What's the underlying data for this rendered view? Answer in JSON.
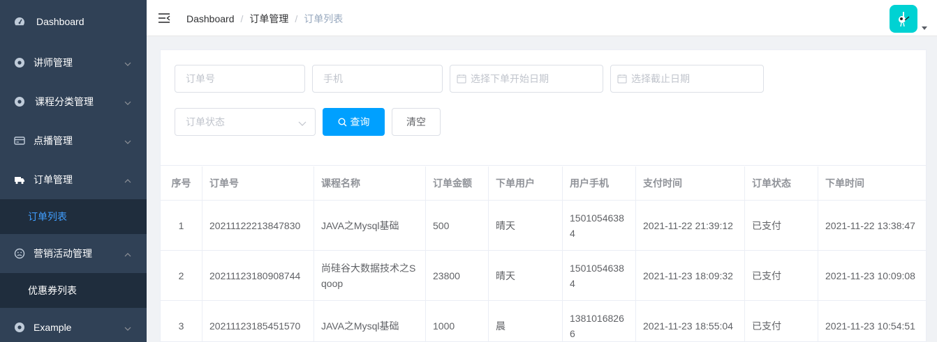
{
  "sidebar": {
    "items": [
      {
        "label": "Dashboard",
        "icon": "dashboard-icon",
        "has_arrow": false
      },
      {
        "label": "讲师管理",
        "icon": "circle-icon",
        "has_arrow": true,
        "arrow": "down"
      },
      {
        "label": "课程分类管理",
        "icon": "circle-icon",
        "has_arrow": true,
        "arrow": "down"
      },
      {
        "label": "点播管理",
        "icon": "card-icon",
        "has_arrow": true,
        "arrow": "down"
      },
      {
        "label": "订单管理",
        "icon": "truck-icon",
        "has_arrow": true,
        "arrow": "up"
      },
      {
        "label": "营销活动管理",
        "icon": "face-icon",
        "has_arrow": true,
        "arrow": "up"
      },
      {
        "label": "Example",
        "icon": "circle-icon",
        "has_arrow": true,
        "arrow": "down"
      }
    ],
    "order_sub": [
      {
        "label": "订单列表",
        "active": true
      }
    ],
    "marketing_sub": [
      {
        "label": "优惠券列表",
        "active": false
      }
    ]
  },
  "navbar": {
    "breadcrumb": [
      "Dashboard",
      "订单管理",
      "订单列表"
    ],
    "separator": "/"
  },
  "filters": {
    "order_no_placeholder": "订单号",
    "phone_placeholder": "手机",
    "start_date_placeholder": "选择下单开始日期",
    "end_date_placeholder": "选择截止日期",
    "status_placeholder": "订单状态",
    "search_label": "查询",
    "clear_label": "清空"
  },
  "table": {
    "headers": [
      "序号",
      "订单号",
      "课程名称",
      "订单金额",
      "下单用户",
      "用户手机",
      "支付时间",
      "订单状态",
      "下单时间"
    ],
    "rows": [
      [
        "1",
        "20211122213847830",
        "JAVA之Mysql基础",
        "500",
        "晴天",
        "15010546384",
        "2021-11-22 21:39:12",
        "已支付",
        "2021-11-22 13:38:47"
      ],
      [
        "2",
        "20211123180908744",
        "尚硅谷大数据技术之Sqoop",
        "23800",
        "晴天",
        "15010546384",
        "2021-11-23 18:09:32",
        "已支付",
        "2021-11-23 10:09:08"
      ],
      [
        "3",
        "20211123185451570",
        "JAVA之Mysql基础",
        "1000",
        "晨",
        "13810168266",
        "2021-11-23 18:55:04",
        "已支付",
        "2021-11-23 10:54:51"
      ]
    ]
  },
  "colors": {
    "sidebar_bg": "#304156",
    "submenu_bg": "#1f2d3d",
    "active": "#409eff",
    "primary_button": "#00a0ff",
    "avatar_bg": "#00d2d3"
  }
}
